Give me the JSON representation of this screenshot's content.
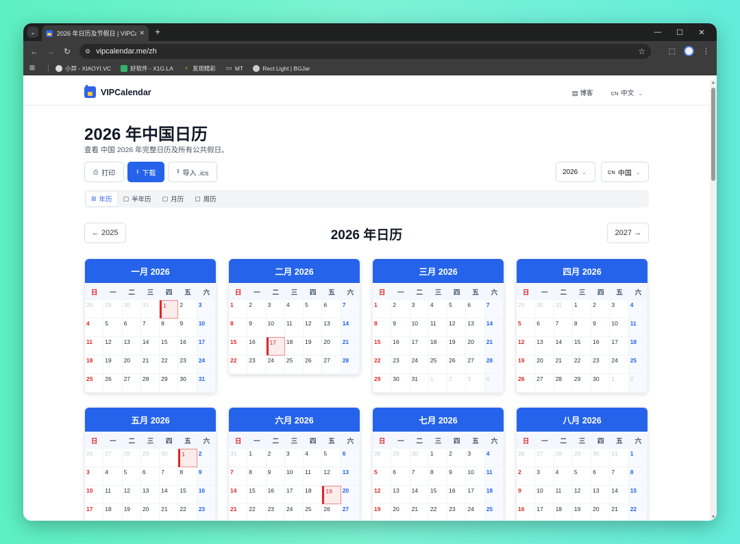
{
  "browser": {
    "tab_title": "2026 年日历及节假日 | VIPCal...",
    "tab_close": "✕",
    "new_tab": "+",
    "url": "vipcalendar.me/zh",
    "bookmarks": [
      {
        "label": "小羿 - XIAOYI.VC"
      },
      {
        "label": "好软件 - X1G.LA"
      },
      {
        "label": "发现精彩"
      },
      {
        "label": "MT"
      },
      {
        "label": "Rect Light | BGJar"
      }
    ],
    "controls": {
      "minimize": "—",
      "maximize": "☐",
      "close": "✕"
    },
    "colors": {
      "frame": "#1f2020",
      "toolbar": "#3c3c3c"
    }
  },
  "site": {
    "brand": "VIPCalendar",
    "blog": "博客",
    "lang_flag": "CN",
    "lang": "中文"
  },
  "page": {
    "title": "2026 年中国日历",
    "subtitle": "查看 中国 2026 年完整日历及所有公共假日。",
    "actions": {
      "print": "打印",
      "download": "下载",
      "import": "导入 .ics"
    },
    "year_select": "2026",
    "country_flag": "CN",
    "country_select": "中国",
    "view_tabs": [
      "年历",
      "半年历",
      "月历",
      "周历"
    ],
    "active_view": 0,
    "prev_year": "← 2025",
    "next_year": "2027 →",
    "year_title": "2026 年日历",
    "weekdays": [
      "日",
      "一",
      "二",
      "三",
      "四",
      "五",
      "六"
    ],
    "accent": "#2563eb",
    "holiday_color": "#dc2626"
  },
  "months": [
    {
      "title": "一月 2026",
      "days": [
        "28",
        "29",
        "30",
        "31",
        "1",
        "2",
        "3",
        "4",
        "5",
        "6",
        "7",
        "8",
        "9",
        "10",
        "11",
        "12",
        "13",
        "14",
        "15",
        "16",
        "17",
        "18",
        "19",
        "20",
        "21",
        "22",
        "23",
        "24",
        "25",
        "26",
        "27",
        "28",
        "29",
        "30",
        "31"
      ],
      "lead": 4,
      "trail": 0,
      "holidays": [
        4
      ]
    },
    {
      "title": "二月 2026",
      "days": [
        "1",
        "2",
        "3",
        "4",
        "5",
        "6",
        "7",
        "8",
        "9",
        "10",
        "11",
        "12",
        "13",
        "14",
        "15",
        "16",
        "17",
        "18",
        "19",
        "20",
        "21",
        "22",
        "23",
        "24",
        "25",
        "26",
        "27",
        "28"
      ],
      "lead": 0,
      "trail": 0,
      "holidays": [
        16
      ]
    },
    {
      "title": "三月 2026",
      "days": [
        "1",
        "2",
        "3",
        "4",
        "5",
        "6",
        "7",
        "8",
        "9",
        "10",
        "11",
        "12",
        "13",
        "14",
        "15",
        "16",
        "17",
        "18",
        "19",
        "20",
        "21",
        "22",
        "23",
        "24",
        "25",
        "26",
        "27",
        "28",
        "29",
        "30",
        "31",
        "1",
        "2",
        "3",
        "4"
      ],
      "lead": 0,
      "trail": 4,
      "holidays": []
    },
    {
      "title": "四月 2026",
      "days": [
        "29",
        "30",
        "31",
        "1",
        "2",
        "3",
        "4",
        "5",
        "6",
        "7",
        "8",
        "9",
        "10",
        "11",
        "12",
        "13",
        "14",
        "15",
        "16",
        "17",
        "18",
        "19",
        "20",
        "21",
        "22",
        "23",
        "24",
        "25",
        "26",
        "27",
        "28",
        "29",
        "30",
        "1",
        "2"
      ],
      "lead": 3,
      "trail": 2,
      "holidays": []
    },
    {
      "title": "五月 2026",
      "days": [
        "26",
        "27",
        "28",
        "29",
        "30",
        "1",
        "2",
        "3",
        "4",
        "5",
        "6",
        "7",
        "8",
        "9",
        "10",
        "11",
        "12",
        "13",
        "14",
        "15",
        "16",
        "17",
        "18",
        "19",
        "20",
        "21",
        "22",
        "23"
      ],
      "lead": 5,
      "trail": 0,
      "holidays": [
        5
      ]
    },
    {
      "title": "六月 2026",
      "days": [
        "31",
        "1",
        "2",
        "3",
        "4",
        "5",
        "6",
        "7",
        "8",
        "9",
        "10",
        "11",
        "12",
        "13",
        "14",
        "15",
        "16",
        "17",
        "18",
        "19",
        "20",
        "21",
        "22",
        "23",
        "24",
        "25",
        "26",
        "27"
      ],
      "lead": 1,
      "trail": 0,
      "holidays": [
        19
      ]
    },
    {
      "title": "七月 2026",
      "days": [
        "28",
        "29",
        "30",
        "1",
        "2",
        "3",
        "4",
        "5",
        "6",
        "7",
        "8",
        "9",
        "10",
        "11",
        "12",
        "13",
        "14",
        "15",
        "16",
        "17",
        "18",
        "19",
        "20",
        "21",
        "22",
        "23",
        "24",
        "25"
      ],
      "lead": 3,
      "trail": 0,
      "holidays": []
    },
    {
      "title": "八月 2026",
      "days": [
        "26",
        "27",
        "28",
        "29",
        "30",
        "31",
        "1",
        "2",
        "3",
        "4",
        "5",
        "6",
        "7",
        "8",
        "9",
        "10",
        "11",
        "12",
        "13",
        "14",
        "15",
        "16",
        "17",
        "18",
        "19",
        "20",
        "21",
        "22"
      ],
      "lead": 6,
      "trail": 0,
      "holidays": []
    }
  ]
}
